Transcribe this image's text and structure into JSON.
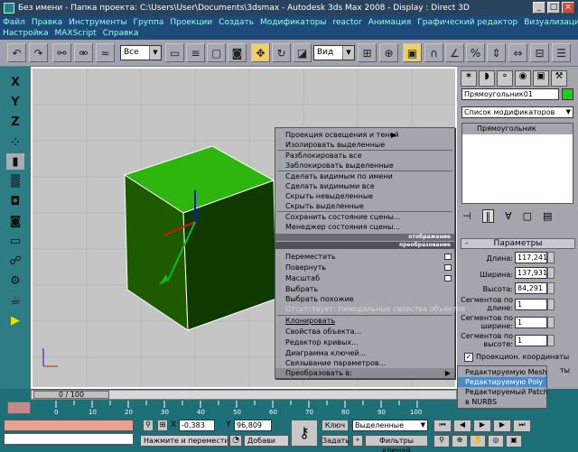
{
  "titlebar": {
    "app_title": "Без имени    - Папка проекта: C:\\Users\\User\\Documents\\3dsmax    - Autodesk 3ds Max 2008    - Display : Direct 3D",
    "minimize": "_",
    "maximize": "□",
    "close": "×"
  },
  "menu": [
    "Файл",
    "Правка",
    "Инструменты",
    "Группа",
    "Проекции",
    "Создать",
    "Модификаторы",
    "reactor",
    "Анимация",
    "Графический редактор",
    "Визуализация",
    "Настройка",
    "MAXScript",
    "Справка"
  ],
  "toolbar": {
    "selection_filter": "Все",
    "reference_coord": "Вид"
  },
  "context_menu": {
    "items": {
      "i0": "Проекция освещения и теней",
      "i1": "Изолировать выделенные",
      "i2": "Разблокировать все",
      "i3": "Заблокировать выделенные",
      "i4": "Сделать видимым по имени",
      "i5": "Сделать видимыми все",
      "i6": "Скрыть невыделенные",
      "i7": "Скрыть выделенные",
      "i8": "Сохранить состояние сцены...",
      "i9": "Менеджер состояния сцены...",
      "i10": "Переместить",
      "i11": "Повернуть",
      "i12": "Масштаб",
      "i13": "Выбрать",
      "i14": "Выбрать похожие",
      "i15": "Отсутствует: Немодальные свойства объектов",
      "i16": "Клонировать",
      "i17": "Свойства объекта...",
      "i18": "Редактор кривых...",
      "i19": "Диаграмма ключей...",
      "i20": "Связывание параметров...",
      "i21": "Преобразовать в:"
    },
    "header_display": "отображение",
    "header_transform": "преобразование"
  },
  "submenu": {
    "s0": "Редактируемую Mesh",
    "s1": "Редактируемую Poly",
    "s2": "Редактируемый Patch",
    "s3": "в NURBS"
  },
  "command_panel": {
    "object_name": "Прямоугольник01",
    "modifier_list": "Список модификаторов",
    "stack_item": "Прямоугольник",
    "rollout_title": "Параметры",
    "rollout_sign": "-",
    "length_label": "Длина:",
    "length_value": "117,241",
    "width_label": "Ширина:",
    "width_value": "137,931",
    "height_label": "Высота:",
    "height_value": "84,291",
    "len_segs_label": "Сегментов по длине:",
    "len_segs_value": "1",
    "wid_segs_label": "Сегментов по ширине:",
    "wid_segs_value": "1",
    "hei_segs_label": "Сегментов по высоте:",
    "hei_segs_value": "1",
    "mapping_label": "Проекцион. координаты",
    "partial_text": "ты"
  },
  "bottom": {
    "time_slider": "0 / 100",
    "ticks": [
      "0",
      "10",
      "20",
      "30",
      "40",
      "50",
      "60",
      "70",
      "80",
      "90",
      "100"
    ],
    "x_label": "X",
    "x_value": "-0,383",
    "y_label": "Y",
    "y_value": "96,809",
    "status_text": "Нажмите и переместите",
    "add_text": "Добави",
    "key_label": "Ключ",
    "key_mode": "Выделенные",
    "set_label": "Задать",
    "key_filters": "Фильтры ключей"
  },
  "colors": {
    "box_front": "#1d5a00",
    "box_top": "#2eb50e",
    "viewport_bg": "#c5c5c5",
    "menu_bg": "#1d4a78",
    "teal": "#2f7d84"
  }
}
